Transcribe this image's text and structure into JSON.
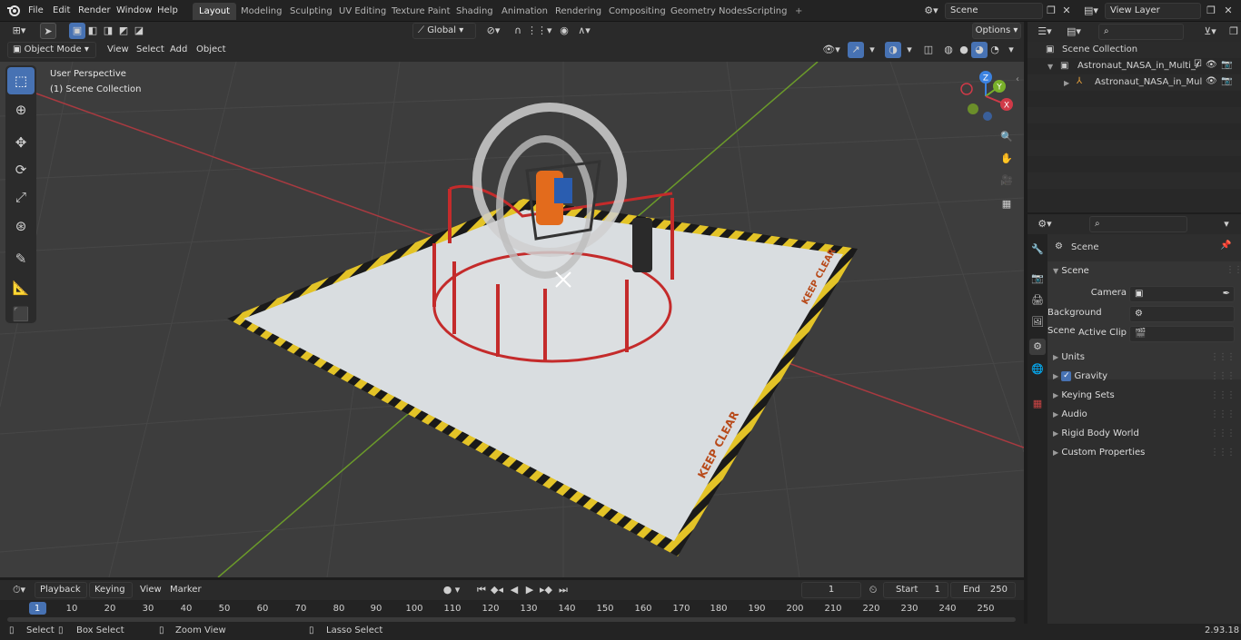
{
  "app": {
    "version": "2.93.18"
  },
  "topbar": {
    "menus": [
      "File",
      "Edit",
      "Render",
      "Window",
      "Help"
    ],
    "workspaces": [
      "Layout",
      "Modeling",
      "Sculpting",
      "UV Editing",
      "Texture Paint",
      "Shading",
      "Animation",
      "Rendering",
      "Compositing",
      "Geometry Nodes",
      "Scripting"
    ],
    "active_workspace": "Layout",
    "scene_name": "Scene",
    "view_layer": "View Layer"
  },
  "viewport": {
    "mode": "Object Mode",
    "menus": [
      "View",
      "Select",
      "Add",
      "Object"
    ],
    "orientation": "Global",
    "options_label": "Options",
    "overlay_title": "User Perspective",
    "overlay_sub": "(1) Scene Collection",
    "gizmo": {
      "x": "X",
      "y": "Y",
      "z": "Z"
    },
    "floor_text_1": "KEEP CLEAR",
    "floor_text_2": "KEEP CLEAR"
  },
  "outliner": {
    "root": "Scene Collection",
    "items": [
      {
        "label": "Astronaut_NASA_in_Multi_Axi"
      },
      {
        "label": "Astronaut_NASA_in_Mult"
      }
    ]
  },
  "properties": {
    "context": "Scene",
    "panel": "Scene",
    "fields": [
      {
        "label": "Camera"
      },
      {
        "label": "Background Scene"
      },
      {
        "label": "Active Clip"
      }
    ],
    "subpanels": [
      "Units",
      "Gravity",
      "Keying Sets",
      "Audio",
      "Rigid Body World",
      "Custom Properties"
    ]
  },
  "timeline": {
    "menus": [
      "Playback",
      "Keying",
      "View",
      "Marker"
    ],
    "current_frame": "1",
    "start_label": "Start",
    "start": "1",
    "end_label": "End",
    "end": "250",
    "ticks": [
      "1",
      "10",
      "20",
      "30",
      "40",
      "50",
      "60",
      "70",
      "80",
      "90",
      "100",
      "110",
      "120",
      "130",
      "140",
      "150",
      "160",
      "170",
      "180",
      "190",
      "200",
      "210",
      "220",
      "230",
      "240",
      "250"
    ]
  },
  "statusbar": {
    "items": [
      "Select",
      "Box Select",
      "Zoom View",
      "Lasso Select"
    ]
  }
}
